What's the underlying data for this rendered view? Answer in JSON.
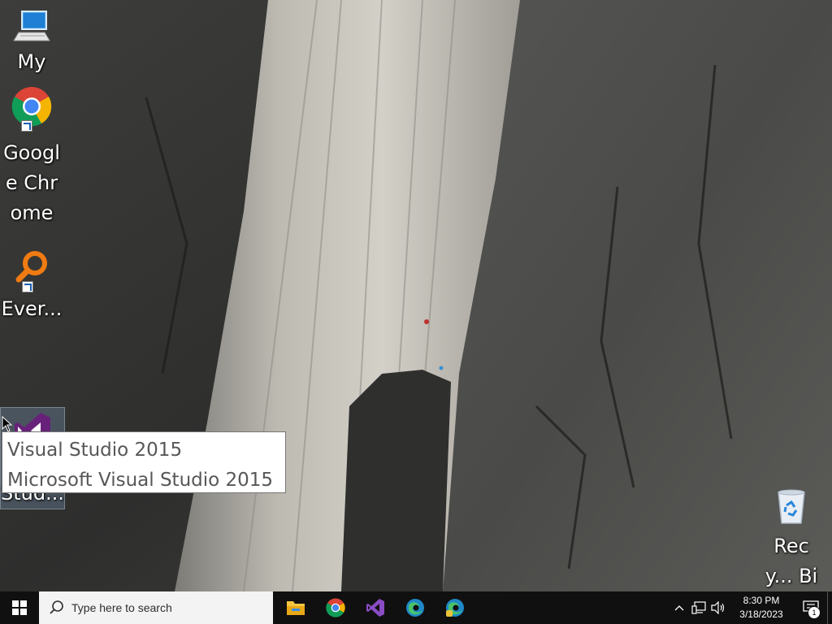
{
  "desktop": {
    "icons": [
      {
        "id": "this-pc",
        "label": "My"
      },
      {
        "id": "chrome",
        "label": "Google Chrome"
      },
      {
        "id": "everything",
        "label": "Ever..."
      },
      {
        "id": "visual-studio",
        "label": "Stud..."
      },
      {
        "id": "recycle-bin",
        "label": "Recy... Bin"
      }
    ],
    "tooltip": {
      "line1": "Visual Studio 2015",
      "line2": "Microsoft Visual Studio 2015"
    }
  },
  "taskbar": {
    "search_placeholder": "Type here to search",
    "apps": [
      {
        "icon": "file-explorer-icon"
      },
      {
        "icon": "chrome-icon"
      },
      {
        "icon": "visual-studio-icon"
      },
      {
        "icon": "edge-icon"
      },
      {
        "icon": "edge-beta-icon"
      }
    ],
    "clock": {
      "time": "8:30 PM",
      "date": "3/18/2023"
    },
    "notification_count": "1"
  },
  "colors": {
    "taskbar_bg": "#101010",
    "search_bg": "#f3f3f3",
    "vs_purple": "#68217a",
    "windows_accent": "#ffffff"
  }
}
